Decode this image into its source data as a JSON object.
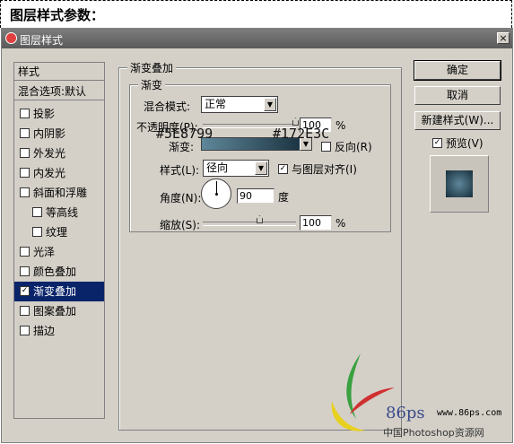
{
  "header": {
    "title": "图层样式参数："
  },
  "dialog": {
    "title": "图层样式",
    "close_glyph": "×"
  },
  "styles_list": {
    "heading": "样式",
    "blend_options": "混合选项:默认",
    "items": [
      {
        "label": "投影",
        "checked": false,
        "sub": false
      },
      {
        "label": "内阴影",
        "checked": false,
        "sub": false
      },
      {
        "label": "外发光",
        "checked": false,
        "sub": false
      },
      {
        "label": "内发光",
        "checked": false,
        "sub": false
      },
      {
        "label": "斜面和浮雕",
        "checked": false,
        "sub": false
      },
      {
        "label": "等高线",
        "checked": false,
        "sub": true
      },
      {
        "label": "纹理",
        "checked": false,
        "sub": true
      },
      {
        "label": "光泽",
        "checked": false,
        "sub": false
      },
      {
        "label": "颜色叠加",
        "checked": false,
        "sub": false
      },
      {
        "label": "渐变叠加",
        "checked": true,
        "sub": false
      },
      {
        "label": "图案叠加",
        "checked": false,
        "sub": false
      },
      {
        "label": "描边",
        "checked": false,
        "sub": false
      }
    ]
  },
  "gradient_overlay": {
    "section_title": "渐变叠加",
    "group_title": "渐变",
    "blend_mode_label": "混合模式:",
    "blend_mode_value": "正常",
    "opacity_label": "不透明度(P):",
    "opacity_value": "100",
    "opacity_fraction": 1.0,
    "gradient_label": "渐变:",
    "reverse_label": "反向(R)",
    "style_label": "样式(L):",
    "style_value": "径向",
    "align_label": "与图层对齐(I)",
    "angle_label": "角度(N):",
    "angle_value": "90",
    "angle_unit": "度",
    "scale_label": "缩放(S):",
    "scale_value": "100",
    "scale_fraction": 0.5,
    "percent": "%"
  },
  "annotations": {
    "color_start": "#5E8799",
    "color_end": "#172E3C"
  },
  "buttons": {
    "ok": "确定",
    "cancel": "取消",
    "new_style": "新建样式(W)...",
    "preview": "预览(V)"
  },
  "watermark": {
    "brand": "86ps",
    "url": "www.86ps.com",
    "caption": "中国Photoshop资源网"
  },
  "colors": {
    "gradient_start": "#5e8799",
    "gradient_end": "#172e3c",
    "selection": "#0a246a",
    "dialog_bg": "#d4d0c8"
  }
}
